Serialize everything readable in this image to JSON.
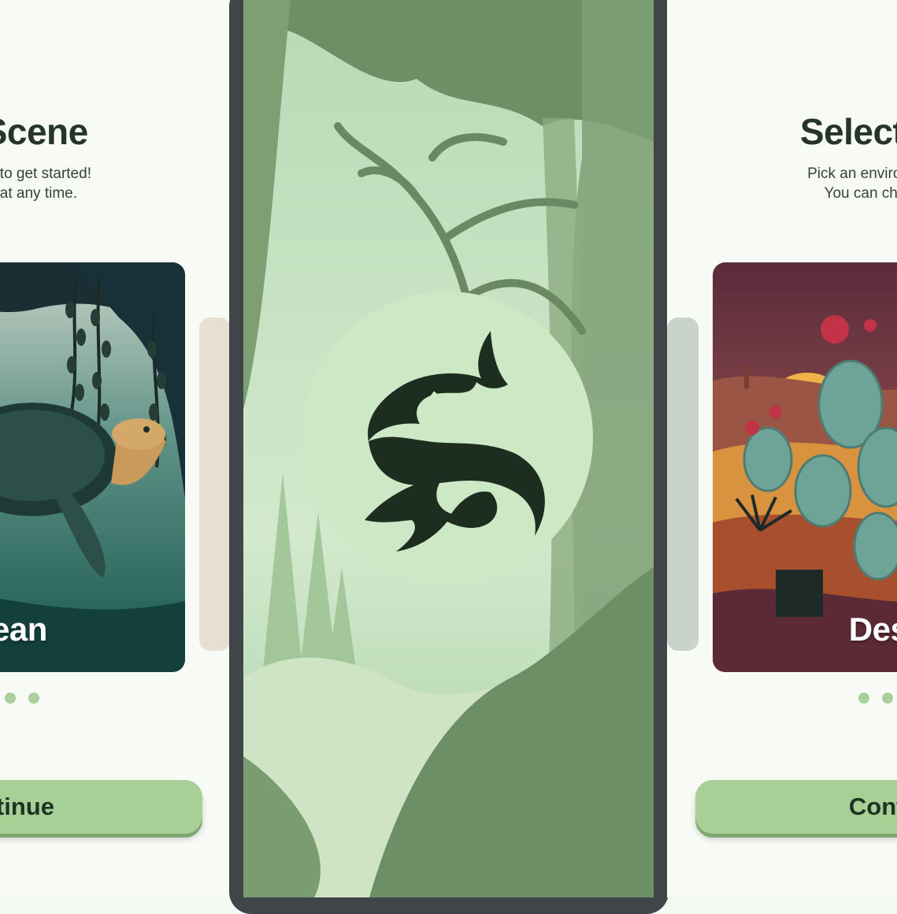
{
  "left_screen": {
    "title": "t a Scene",
    "subtitle_lines": [
      "ent theme to get started!",
      "nge this at any time."
    ],
    "card_label": "cean",
    "continue_label": "ontinue",
    "page_dots": 3
  },
  "splash_screen": {
    "logo_icon": "animals-s-logo-icon",
    "colors": {
      "forest_dark": "#6e8f66",
      "forest_mist": "#b9dcb6",
      "logo_circle": "#cde8c4",
      "logo_mark": "#1d2e20"
    }
  },
  "right_screen": {
    "title": "Select a S",
    "subtitle_lines": [
      "Pick an environment the",
      "You can change thi"
    ],
    "card_label": "Dese",
    "continue_label": "Contin",
    "page_dots": 3
  },
  "colors": {
    "accent": "#a6d096",
    "dot": "#a9cf9b",
    "text_dark": "#253528",
    "phone_frame": "#3f4549"
  }
}
